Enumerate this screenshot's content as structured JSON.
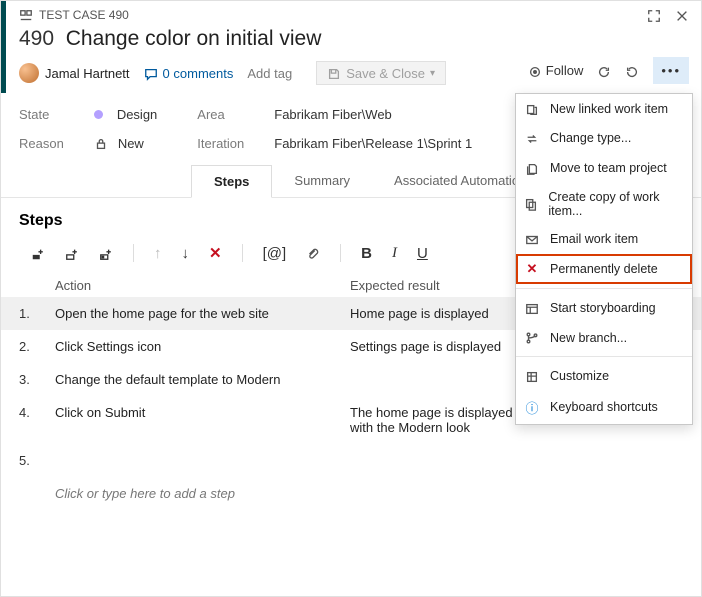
{
  "header": {
    "type_label": "TEST CASE 490",
    "id": "490",
    "title": "Change color on initial view"
  },
  "meta": {
    "assignee": "Jamal Hartnett",
    "comments": "0 comments",
    "add_tag": "Add tag",
    "save_close": "Save & Close",
    "follow": "Follow"
  },
  "fields": {
    "state_label": "State",
    "state_value": "Design",
    "reason_label": "Reason",
    "reason_value": "New",
    "area_label": "Area",
    "area_value": "Fabrikam Fiber\\Web",
    "iteration_label": "Iteration",
    "iteration_value": "Fabrikam Fiber\\Release 1\\Sprint 1"
  },
  "tabs": {
    "t1": "Steps",
    "t2": "Summary",
    "t3": "Associated Automation"
  },
  "steps_header": "Steps",
  "columns": {
    "action": "Action",
    "expected": "Expected result"
  },
  "steps": [
    {
      "n": "1.",
      "action": "Open the home page for the web site",
      "expected": "Home page is displayed"
    },
    {
      "n": "2.",
      "action": "Click Settings icon",
      "expected": "Settings page is displayed"
    },
    {
      "n": "3.",
      "action": "Change the default template to Modern",
      "expected": ""
    },
    {
      "n": "4.",
      "action": "Click on Submit",
      "expected": "The home page is displayed with the Modern look"
    },
    {
      "n": "5.",
      "action": "",
      "expected": ""
    }
  ],
  "placeholder": "Click or type here to add a step",
  "menu": {
    "m1": "New linked work item",
    "m2": "Change type...",
    "m3": "Move to team project",
    "m4": "Create copy of work item...",
    "m5": "Email work item",
    "m6": "Permanently delete",
    "m7": "Start storyboarding",
    "m8": "New branch...",
    "m9": "Customize",
    "m10": "Keyboard shortcuts"
  }
}
